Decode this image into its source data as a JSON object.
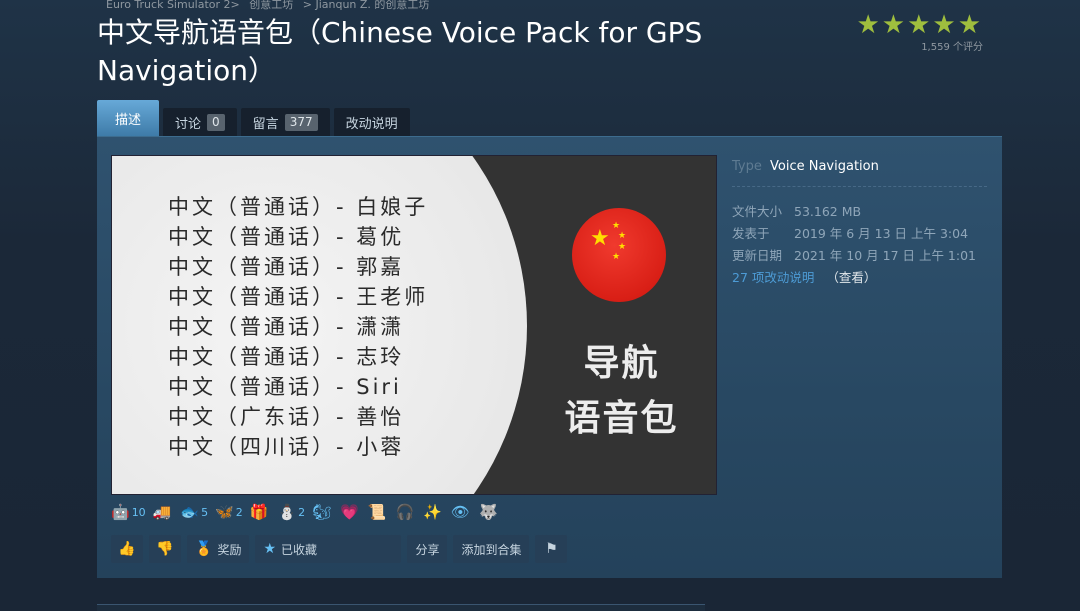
{
  "breadcrumb": [
    "Euro Truck Simulator 2>",
    "创意工坊",
    "> Jianqun Z. 的创意工坊"
  ],
  "title": "中文导航语音包（Chinese Voice Pack for GPS Navigation）",
  "rating": {
    "stars": "★★★★★",
    "count_text": "1,559 个评分"
  },
  "tabs": [
    {
      "label": "描述",
      "active": true
    },
    {
      "label": "讨论",
      "count": "0"
    },
    {
      "label": "留言",
      "count": "377"
    },
    {
      "label": "改动说明"
    }
  ],
  "preview": {
    "voice_lines": [
      "中文（普通话）- 白娘子",
      "中文（普通话）- 葛优",
      "中文（普通话）- 郭嘉",
      "中文（普通话）- 王老师",
      "中文（普通话）- 潇潇",
      "中文（普通话）- 志玲",
      "中文（普通话）- Siri",
      "中文（广东话）- 善怡",
      "中文（四川话）- 小蓉"
    ],
    "nav_title_line1": "导航",
    "nav_title_line2": "语音包",
    "flag_icon": "china-flag-icon"
  },
  "info": {
    "type_label": "Type",
    "type_value": "Voice Navigation",
    "rows": [
      {
        "k": "文件大小",
        "v": "53.162 MB"
      },
      {
        "k": "发表于",
        "v": "2019 年 6 月 13 日 上午 3:04"
      },
      {
        "k": "更新日期",
        "v": "2021 年 10 月 17 日 上午 1:01"
      }
    ],
    "changes_link": "27 项改动说明",
    "changes_view": "（查看）"
  },
  "awards": [
    {
      "icon": "🤖",
      "count": "10"
    },
    {
      "icon": "🚚",
      "count": ""
    },
    {
      "icon": "🐟",
      "count": "5"
    },
    {
      "icon": "🦋",
      "count": "2"
    },
    {
      "icon": "🎁",
      "count": ""
    },
    {
      "icon": "⛄",
      "count": "2"
    },
    {
      "icon": "🐿",
      "count": ""
    },
    {
      "icon": "💗",
      "count": ""
    },
    {
      "icon": "📜",
      "count": ""
    },
    {
      "icon": "🎧",
      "count": ""
    },
    {
      "icon": "✨",
      "count": ""
    },
    {
      "icon": "👁",
      "count": ""
    },
    {
      "icon": "🐺",
      "count": ""
    }
  ],
  "actions": {
    "award_label": "奖励",
    "favorited_label": "已收藏",
    "share_label": "分享",
    "add_collection_label": "添加到合集"
  }
}
